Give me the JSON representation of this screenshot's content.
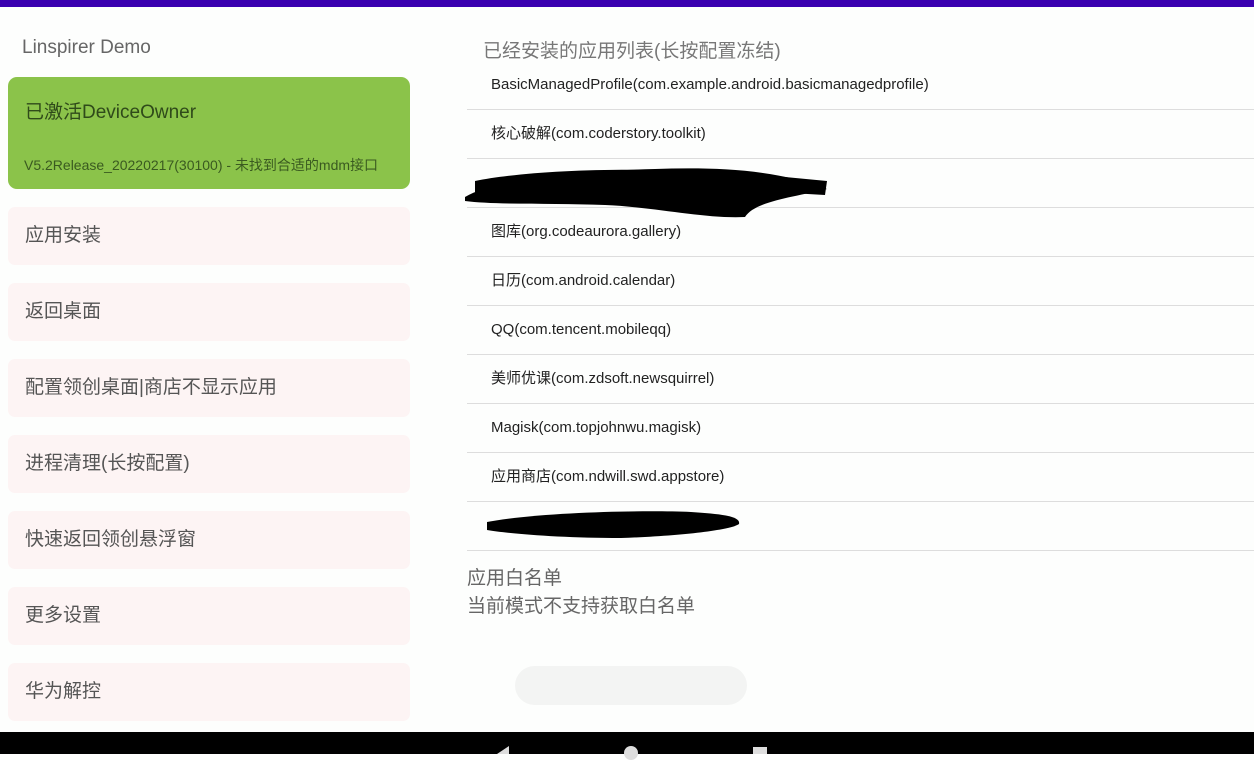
{
  "app_title": "Linspirer Demo",
  "status_card": {
    "title": "已激活DeviceOwner",
    "subtitle": "V5.2Release_20220217(30100) - 未找到合适的mdm接口",
    "color": "#8bc34a"
  },
  "menu": [
    {
      "label": "应用安装"
    },
    {
      "label": "返回桌面"
    },
    {
      "label": "配置领创桌面|商店不显示应用"
    },
    {
      "label": "进程清理(长按配置)"
    },
    {
      "label": "快速返回领创悬浮窗"
    },
    {
      "label": "更多设置"
    },
    {
      "label": "华为解控"
    }
  ],
  "installed": {
    "title": "已经安装的应用列表(长按配置冻结)",
    "apps": [
      {
        "label": "BasicManagedProfile(com.example.android.basicmanagedprofile)"
      },
      {
        "label": "核心破解(com.coderstory.toolkit)"
      },
      {
        "label": "",
        "redacted": true
      },
      {
        "label": "图库(org.codeaurora.gallery)"
      },
      {
        "label": "日历(com.android.calendar)"
      },
      {
        "label": "QQ(com.tencent.mobileqq)"
      },
      {
        "label": "美师优课(com.zdsoft.newsquirrel)"
      },
      {
        "label": "Magisk(com.topjohnwu.magisk)"
      },
      {
        "label": "应用商店(com.ndwill.swd.appstore)"
      },
      {
        "label": "",
        "redacted": true
      }
    ]
  },
  "whitelist": {
    "title": "应用白名单",
    "message": "当前模式不支持获取白名单"
  }
}
